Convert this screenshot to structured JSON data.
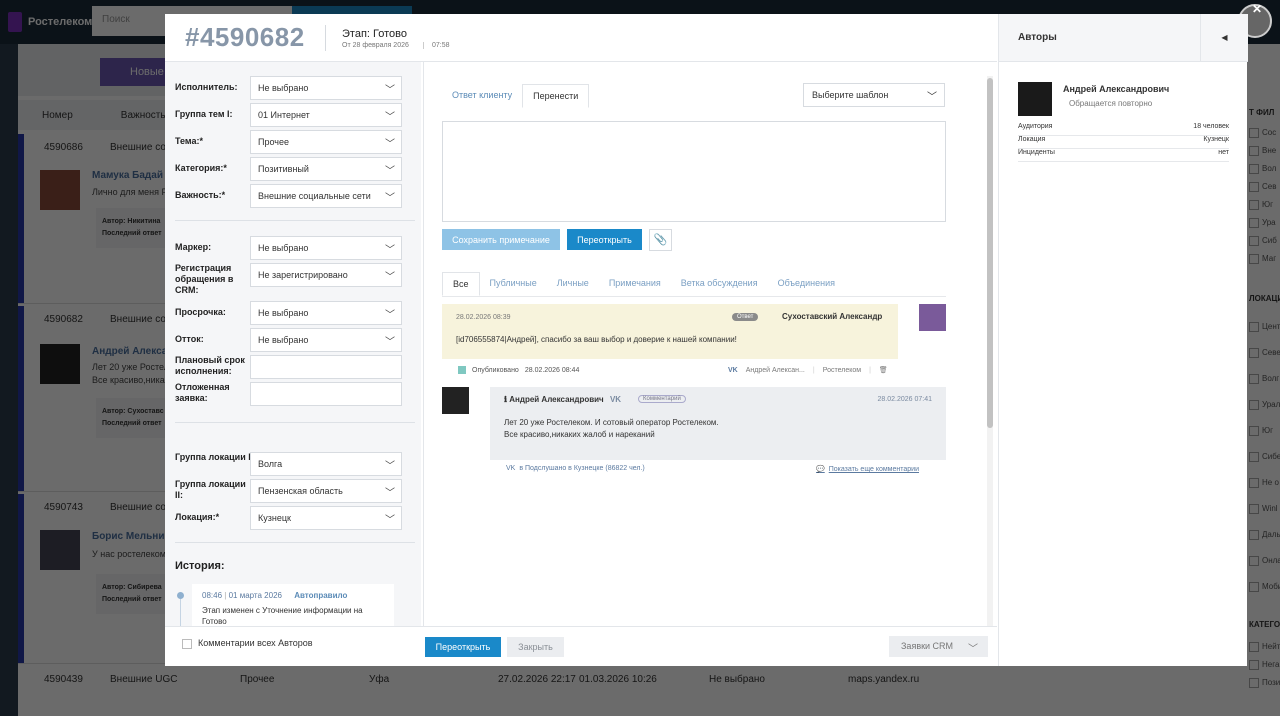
{
  "background": {
    "brand": "Ростелеком",
    "search_placeholder": "Поиск",
    "stage_label": "Новые",
    "columns": [
      "Номер",
      "Важность"
    ],
    "rows": [
      {
        "id": "4590686",
        "category": "Внешние соц",
        "name": "Мамука Бадай",
        "text": "Лично для меня Р",
        "box": "Автор: Никитина\nПоследний ответ"
      },
      {
        "id": "4590682",
        "category": "Внешние соц",
        "name": "Андрей Алексан",
        "text": "Лет 20 уже Ростел\nВсе красиво,ника",
        "box": "Автор: Сухоставс\nПоследний ответ"
      },
      {
        "id": "4590743",
        "category": "Внешние соц",
        "name": "Борис Мельник",
        "text": "У нас ростелеком",
        "box": "Автор: Сибирева\nПоследний ответ"
      }
    ],
    "last_row": {
      "id": "4590439",
      "category": "Внешние UGC",
      "topic": "Прочее",
      "city": "Уфа",
      "created": "27.02.2026 22:17",
      "updated": "01.03.2026 10:26",
      "status": "Не выбрано",
      "link": "maps.yandex.ru"
    },
    "right_filters_head1": "Т ФИЛ",
    "right_filters": [
      "Сос",
      "Вне",
      "Вол",
      "Сев",
      "Юг",
      "Ура",
      "Сиб",
      "Маг"
    ],
    "right_filters_head2": "ЛОКАЦИ",
    "right_filters2": [
      "Цент",
      "Севе",
      "Волг",
      "Урал",
      "Юг",
      "Сибе",
      "Не о",
      "Winl",
      "Даль",
      "Онла",
      "Моби"
    ],
    "right_filters_head3": "КАТЕГО",
    "right_filters3": [
      "Нейт",
      "Нега",
      "Пози"
    ]
  },
  "modal": {
    "ticket_id": "#4590682",
    "stage_title": "Этап: Готово",
    "stage_date": "От 28 февраля 2026",
    "stage_time": "07:58",
    "fields": [
      {
        "label": "Исполнитель:",
        "value": "Не выбрано"
      },
      {
        "label": "Группа тем I:",
        "value": "01 Интернет"
      },
      {
        "label": "Тема:*",
        "value": "Прочее"
      },
      {
        "label": "Категория:*",
        "value": "Позитивный"
      },
      {
        "label": "Важность:*",
        "value": "Внешние социальные сети"
      }
    ],
    "fields2": [
      {
        "label": "Маркер:",
        "value": "Не выбрано"
      },
      {
        "label": "Регистрация обращения в CRM:",
        "value": "Не зарегистрировано"
      },
      {
        "label": "Просрочка:",
        "value": "Не выбрано"
      },
      {
        "label": "Отток:",
        "value": "Не выбрано"
      }
    ],
    "planned_label": "Плановый срок исполнения:",
    "deferred_label": "Отложенная заявка:",
    "fields3": [
      {
        "label": "Группа локации I:",
        "value": "Волга"
      },
      {
        "label": "Группа локации II:",
        "value": "Пензенская область"
      },
      {
        "label": "Локация:*",
        "value": "Кузнецк"
      }
    ],
    "history_title": "История:",
    "history": {
      "time": "08:46",
      "date": "01 марта 2026",
      "actor": "Автоправило",
      "text": "Этап изменен с Уточнение информации на Готово"
    },
    "reply_tabs": [
      "Ответ клиенту",
      "Перенести"
    ],
    "template_select": "Выберите шаблон",
    "save_note": "Сохранить примечание",
    "reopen": "Переоткрыть",
    "feed_tabs": [
      "Все",
      "Публичные",
      "Личные",
      "Примечания",
      "Ветка обсуждения",
      "Объединения"
    ],
    "reply_msg": {
      "date": "28.02.2026 08:39",
      "badge": "Ответ",
      "author": "Сухоставский Александр",
      "text": "[id706555874|Андрей], спасибо за ваш выбор и доверие к нашей компании!"
    },
    "published": {
      "label": "Опубликовано",
      "date": "28.02.2026 08:44",
      "via": "Андрей Алексан...",
      "channel": "Ростелеком"
    },
    "comment": {
      "author": "Андрей Александрович",
      "badge": "Комментарий",
      "date": "28.02.2026 07:41",
      "line1": "Лет 20 уже Ростелеком. И сотовый оператор Ростелеком.",
      "line2": "Все красиво,никаких жалоб и нареканий",
      "source": "в Подслушано в Кузнецке (86822 чел.)",
      "more": "Показать еще комментарии"
    },
    "footer": {
      "all_authors": "Комментарии всех Авторов",
      "reopen": "Переоткрыть",
      "close": "Закрыть",
      "crm": "Заявки CRM"
    },
    "authors": {
      "title": "Авторы",
      "name": "Андрей Александрович",
      "subtitle": "Обращается повторно",
      "stats": [
        {
          "k": "Аудитория",
          "v": "18 человек"
        },
        {
          "k": "Локация",
          "v": "Кузнецк"
        },
        {
          "k": "Инциденты",
          "v": "нет"
        }
      ]
    }
  }
}
